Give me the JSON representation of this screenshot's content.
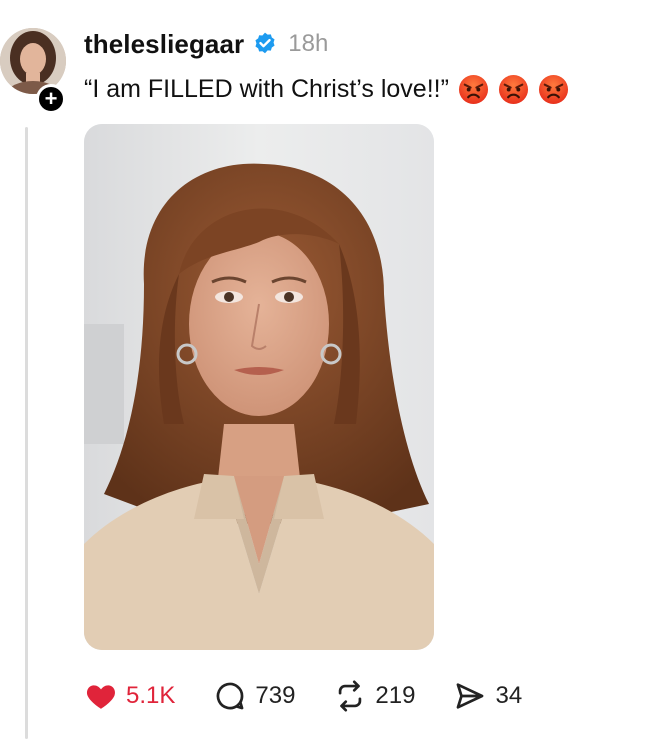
{
  "post": {
    "username": "thelesliegaar",
    "timestamp": "18h",
    "text": "“I am FILLED with Christ’s love!!”",
    "emojis": [
      "angry-face-emoji",
      "angry-face-emoji",
      "angry-face-emoji"
    ],
    "verified": true
  },
  "avatar": {
    "follow_symbol": "+"
  },
  "actions": {
    "likes": "5.1K",
    "replies": "739",
    "reposts": "219",
    "shares": "34",
    "liked": true
  },
  "colors": {
    "like_red": "#e0243a",
    "verified_blue": "#1d9bf0",
    "timestamp_gray": "#9a9a9a"
  }
}
